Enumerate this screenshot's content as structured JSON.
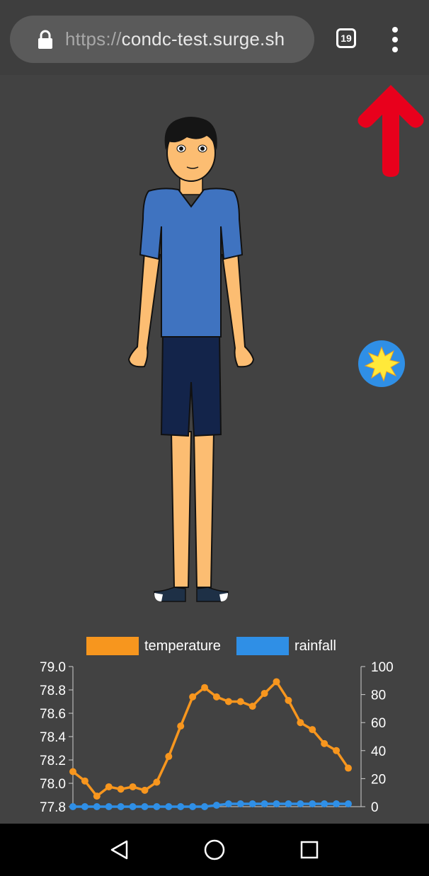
{
  "browser": {
    "url_scheme": "https://",
    "url_host": "condc-test.surge.sh",
    "tab_count": "19",
    "lock_icon": "lock-icon",
    "menu_icon": "more-vert-icon"
  },
  "scene": {
    "arrow_icon": "up-arrow-icon",
    "avatar": "person-avatar",
    "weather_button_icon": "sun-icon",
    "colors": {
      "arrow": "#e8001c",
      "shirt": "#3f73c0",
      "shorts": "#13244a",
      "skin": "#fcbd72",
      "weather_bg": "#2f8fe6",
      "sun": "#ffe93a"
    }
  },
  "chart_data": {
    "type": "line",
    "legend": [
      "temperature",
      "rainfall"
    ],
    "colors": {
      "temperature": "#f7961e",
      "rainfall": "#2f8fe6"
    },
    "x_count": 24,
    "series": [
      {
        "name": "temperature",
        "axis": "left",
        "values": [
          78.1,
          78.02,
          77.89,
          77.97,
          77.95,
          77.97,
          77.94,
          78.01,
          78.23,
          78.49,
          78.74,
          78.82,
          78.74,
          78.7,
          78.7,
          78.66,
          78.77,
          78.87,
          78.71,
          78.52,
          78.46,
          78.34,
          78.28,
          78.13
        ]
      },
      {
        "name": "rainfall",
        "axis": "right",
        "values": [
          0,
          0,
          0,
          0,
          0,
          0,
          0,
          0,
          0,
          0,
          0,
          0,
          1,
          2,
          2,
          2,
          2,
          2,
          2,
          2,
          2,
          2,
          2,
          2
        ]
      }
    ],
    "y_left": {
      "min": 77.8,
      "max": 79.0,
      "ticks": [
        "79.0",
        "78.8",
        "78.6",
        "78.4",
        "78.2",
        "78.0",
        "77.8"
      ]
    },
    "y_right": {
      "min": 0,
      "max": 100,
      "ticks": [
        "100",
        "80",
        "60",
        "40",
        "20",
        "0"
      ]
    }
  },
  "navbar": {
    "back_icon": "back-triangle-icon",
    "home_icon": "home-circle-icon",
    "recents_icon": "recents-square-icon"
  }
}
